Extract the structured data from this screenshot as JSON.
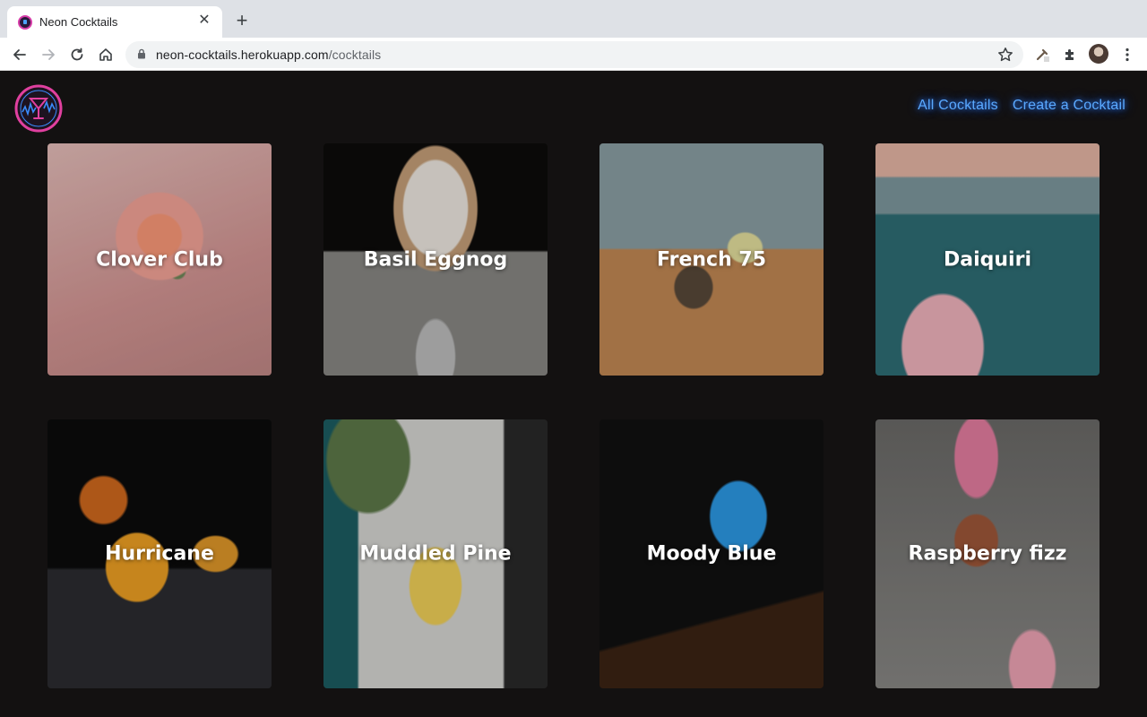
{
  "browser": {
    "tab_title": "Neon Cocktails",
    "url_host": "neon-cocktails.herokuapp.com",
    "url_path": "/cocktails"
  },
  "nav": {
    "all_cocktails": "All Cocktails",
    "create_cocktail": "Create a Cocktail"
  },
  "cocktails": [
    {
      "name": "Clover Club"
    },
    {
      "name": "Basil Eggnog"
    },
    {
      "name": "French 75"
    },
    {
      "name": "Daiquiri"
    },
    {
      "name": "Hurricane"
    },
    {
      "name": "Muddled Pine"
    },
    {
      "name": "Moody Blue"
    },
    {
      "name": "Raspberry fizz"
    }
  ],
  "colors": {
    "page_bg": "#131111",
    "neon_link": "#5aa9ff",
    "logo_pink": "#e0409f",
    "logo_blue": "#3a8cff"
  }
}
